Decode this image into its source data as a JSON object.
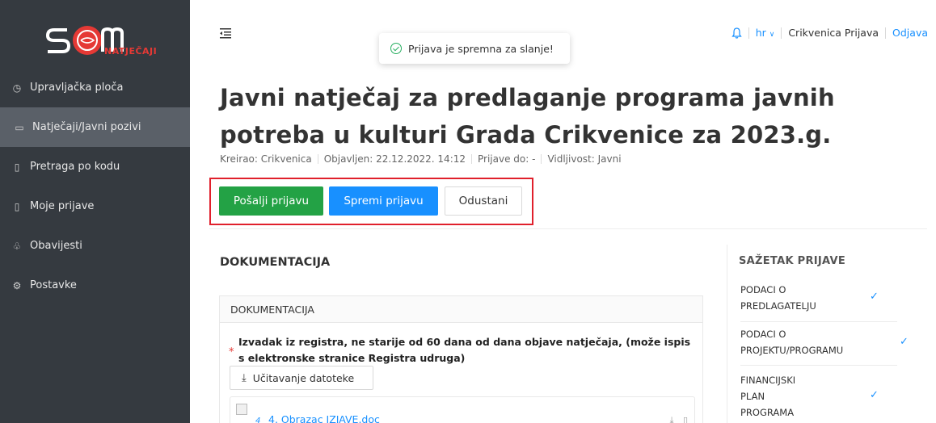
{
  "sidebar": {
    "logo_subtitle": "NATJEČAJI",
    "items": [
      {
        "label": "Upravljačka ploča",
        "icon": "dashboard-icon"
      },
      {
        "label": "Natječaji/Javni pozivi",
        "icon": "folder-open-icon"
      },
      {
        "label": "Pretraga po kodu",
        "icon": "file-icon"
      },
      {
        "label": "Moje prijave",
        "icon": "document-icon"
      },
      {
        "label": "Obavijesti",
        "icon": "bell-icon"
      },
      {
        "label": "Postavke",
        "icon": "gear-icon"
      }
    ]
  },
  "toast": {
    "message": "Prijava je spremna za slanje!"
  },
  "header": {
    "lang": "hr",
    "user": "Crikvenica Prijava",
    "logout": "Odjava"
  },
  "page": {
    "title": "Javni natječaj za predlaganje programa javnih potreba u kulturi Grada Crikvenice za 2023.g.",
    "meta": {
      "created": "Kreirao: Crikvenica",
      "published": "Objavljen: 22.12.2022. 14:12",
      "deadline": "Prijave do: -",
      "visibility": "Vidljivost: Javni"
    }
  },
  "actions": {
    "send": "Pošalji prijavu",
    "save": "Spremi prijavu",
    "cancel": "Odustani"
  },
  "documentation": {
    "section_title": "DOKUMENTACIJA",
    "card_title": "DOKUMENTACIJA",
    "item_text": "Izvadak iz registra, ne starije od 60 dana od dana objave natječaja, (može ispis s elektronske stranice Registra udruga)",
    "required_mark": "*",
    "upload_label": "Učitavanje datoteke",
    "file_number": "4",
    "file_name": "4. Obrazac IZJAVE.doc"
  },
  "summary": {
    "title": "SAŽETAK PRIJAVE",
    "items": [
      {
        "label": "PODACI O PREDLAGATELJU",
        "checked": true
      },
      {
        "label": "PODACI O PROJEKTU/PROGRAMU",
        "checked": true
      },
      {
        "label": "FINANCIJSKI PLAN PROGRAMA",
        "checked": true
      }
    ]
  },
  "colors": {
    "primary": "#1890ff",
    "success": "#23a245",
    "sidebar": "#353a40",
    "highlight": "#e0202c"
  }
}
